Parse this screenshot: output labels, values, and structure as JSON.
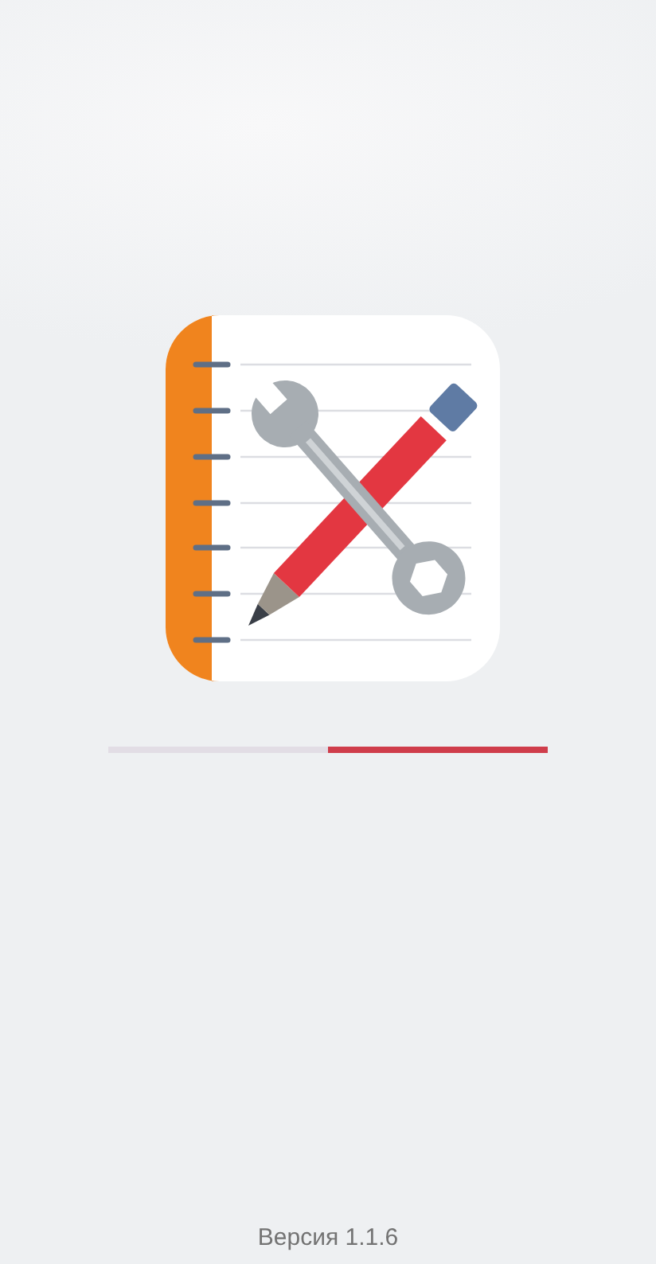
{
  "progress": {
    "level": 0.5
  },
  "version": "Версия 1.1.6"
}
